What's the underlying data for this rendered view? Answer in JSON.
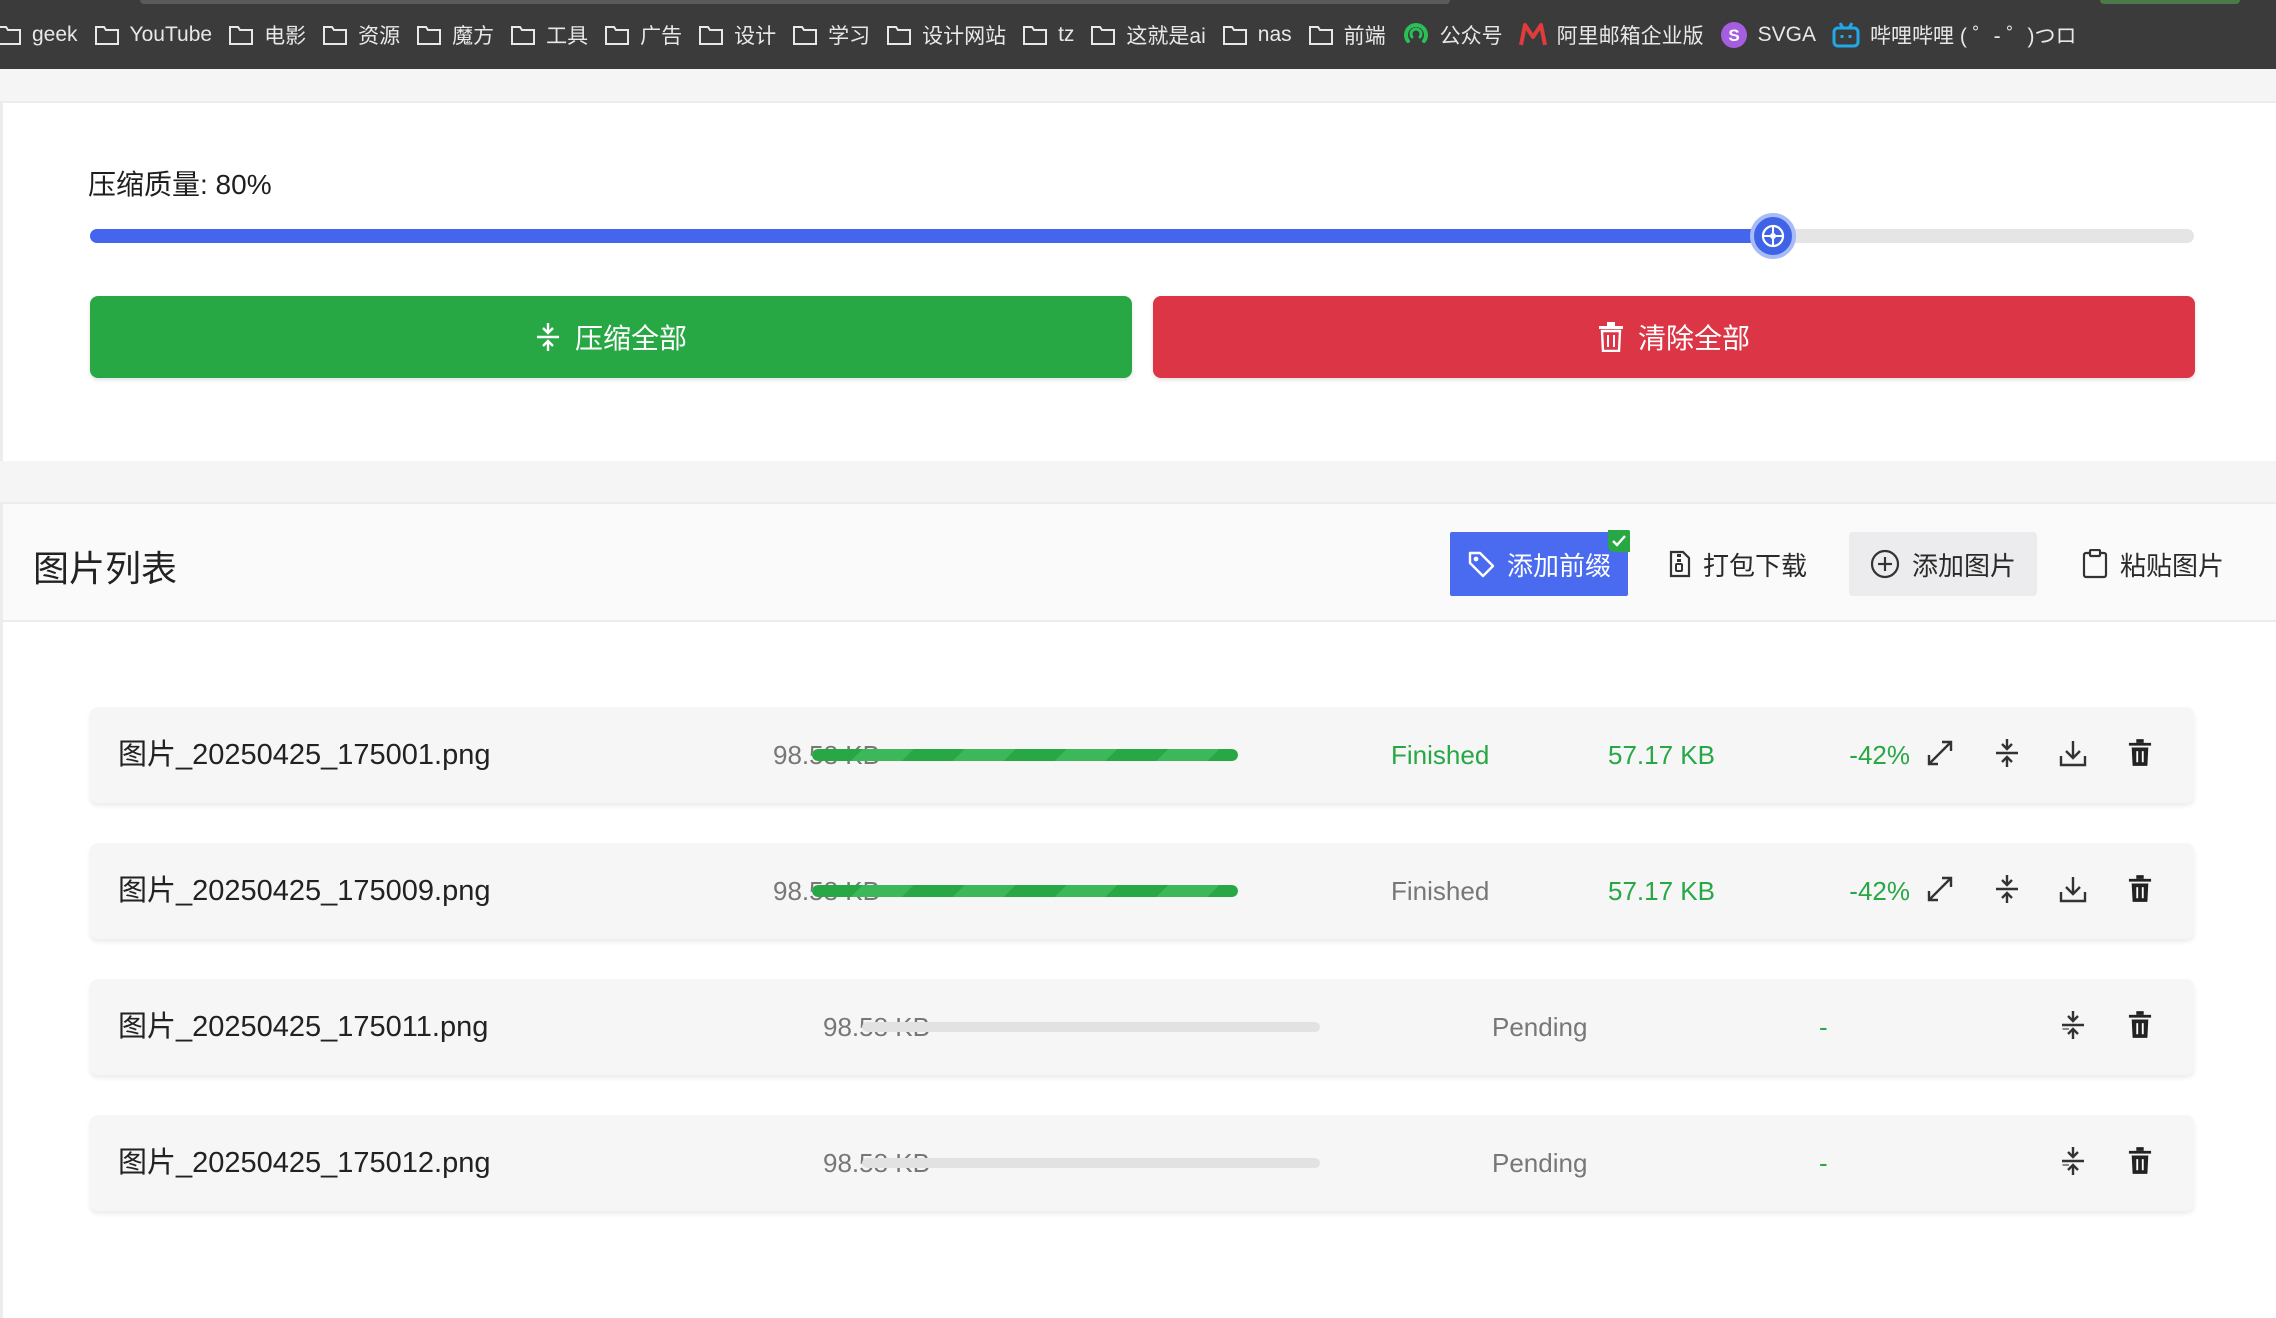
{
  "bookmarks": [
    {
      "label": "geek",
      "icon": "folder-icon"
    },
    {
      "label": "YouTube",
      "icon": "folder-icon"
    },
    {
      "label": "电影",
      "icon": "folder-icon"
    },
    {
      "label": "资源",
      "icon": "folder-icon"
    },
    {
      "label": "魔方",
      "icon": "folder-icon"
    },
    {
      "label": "工具",
      "icon": "folder-icon"
    },
    {
      "label": "广告",
      "icon": "folder-icon"
    },
    {
      "label": "设计",
      "icon": "folder-icon"
    },
    {
      "label": "学习",
      "icon": "folder-icon"
    },
    {
      "label": "设计网站",
      "icon": "folder-icon"
    },
    {
      "label": "tz",
      "icon": "folder-icon"
    },
    {
      "label": "这就是ai",
      "icon": "folder-icon"
    },
    {
      "label": "nas",
      "icon": "folder-icon"
    },
    {
      "label": "前端",
      "icon": "folder-icon"
    },
    {
      "label": "公众号",
      "icon": "wechat-mp-icon"
    },
    {
      "label": "阿里邮箱企业版",
      "icon": "ali-mail-icon"
    },
    {
      "label": "SVGA",
      "icon": "svga-icon"
    },
    {
      "label": "哔哩哔哩 ( ゜- ゜)つロ",
      "icon": "bilibili-icon"
    }
  ],
  "quality": {
    "label": "压缩质量: 80%",
    "value": 80,
    "min": 0,
    "max": 100
  },
  "actions": {
    "compress_all": "压缩全部",
    "clear_all": "清除全部"
  },
  "list": {
    "title": "图片列表",
    "buttons": {
      "add_prefix": "添加前缀",
      "zip_download": "打包下载",
      "add_image": "添加图片",
      "paste_image": "粘贴图片"
    },
    "files": [
      {
        "name": "图片_20250425_175001.png",
        "size": "98.58 KB",
        "progress": 1.0,
        "status": "Finished",
        "status_color": "#28a745",
        "out_size": "57.17 KB",
        "ratio": "-42%"
      },
      {
        "name": "图片_20250425_175009.png",
        "size": "98.58 KB",
        "progress": 1.0,
        "status": "Finished",
        "status_color": "#777777",
        "out_size": "57.17 KB",
        "ratio": "-42%"
      },
      {
        "name": "图片_20250425_175011.png",
        "size": "98.58 KB",
        "progress": 0.0,
        "status": "Pending",
        "status_color": "#777777",
        "out_size": "-",
        "ratio": "-"
      },
      {
        "name": "图片_20250425_175012.png",
        "size": "98.58 KB",
        "progress": 0.0,
        "status": "Pending",
        "status_color": "#777777",
        "out_size": "-",
        "ratio": "-"
      }
    ]
  },
  "colors": {
    "accent": "#4466ee",
    "success": "#28a745",
    "danger": "#dc3545"
  }
}
